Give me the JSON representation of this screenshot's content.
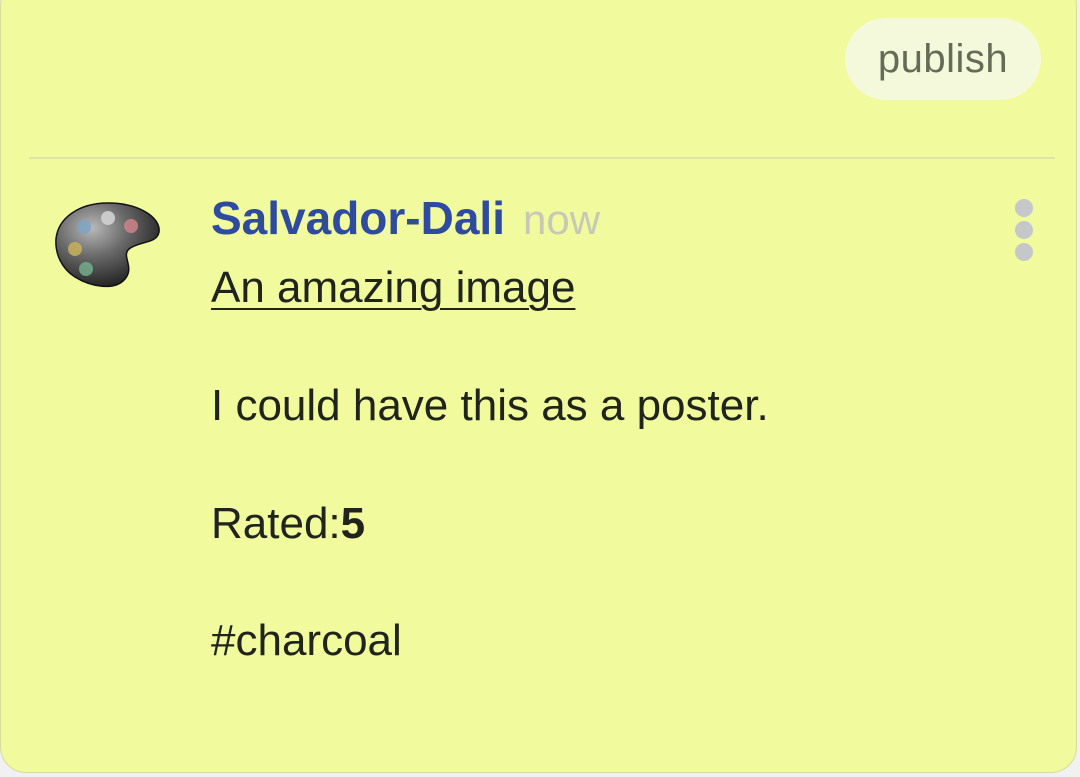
{
  "toolbar": {
    "publish_label": "publish"
  },
  "comment": {
    "author": "Salvador-Dali",
    "time": "now",
    "subject": "An amazing image",
    "body": "I could have this as a poster.",
    "rating_label": "Rated:",
    "rating_value": "5",
    "tag": "#charcoal",
    "avatar_icon": "palette-icon",
    "menu_icon": "more-vertical-icon"
  },
  "colors": {
    "background": "#f1fa9c",
    "author": "#2f4ba0",
    "text": "#20241b",
    "muted": "#c6c8b8"
  }
}
